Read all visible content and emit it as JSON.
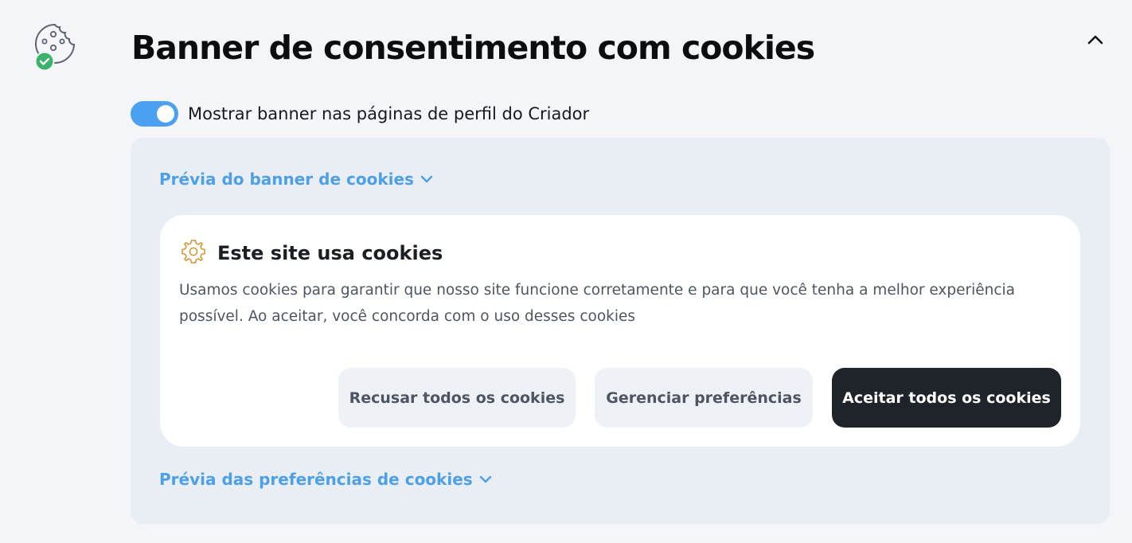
{
  "header": {
    "icon": "cookie-check-icon",
    "title": "Banner de consentimento com cookies",
    "collapse_icon": "chevron-up-icon"
  },
  "toggle": {
    "label": "Mostrar banner nas páginas de perfil do Criador",
    "checked": true,
    "color": "#4ca0f2"
  },
  "preview": {
    "banner_link": "Prévia do banner de cookies",
    "prefs_link": "Prévia das preferências de cookies",
    "link_color": "#4d9fe6",
    "link_icon": "chevron-down-icon",
    "banner": {
      "icon": "gear-icon",
      "title": "Este site usa cookies",
      "description": "Usamos cookies para garantir que nosso site funcione corretamente e para que você tenha a melhor experiência possível. Ao aceitar, você concorda com o uso desses cookies",
      "buttons": {
        "reject": "Recusar todos os cookies",
        "manage": "Gerenciar preferências",
        "accept": "Aceitar todos os cookies"
      }
    }
  }
}
